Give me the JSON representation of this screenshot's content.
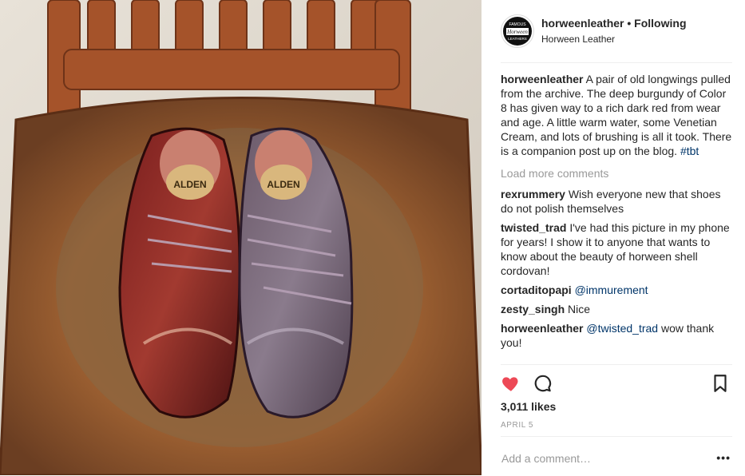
{
  "post": {
    "username": "horweenleather",
    "separator": "•",
    "follow_state": "Following",
    "location": "Horween Leather",
    "avatar_text": {
      "top": "FAMOUS",
      "middle": "Horween",
      "bottom": "LEATHERS"
    },
    "photo_brand": "ALDEN"
  },
  "caption": {
    "username": "horweenleather",
    "text": "A pair of old longwings pulled from the archive. The deep burgundy of Color 8 has given way to a rich dark red from wear and age. A little warm water, some Venetian Cream, and lots of brushing is all it took. There is a companion post up on the blog.",
    "hashtag": "#tbt"
  },
  "load_more": "Load more comments",
  "comments": [
    {
      "username": "rexrummery",
      "mention": "",
      "text": "Wish everyone new that shoes do not polish themselves"
    },
    {
      "username": "twisted_trad",
      "mention": "",
      "text": "I've had this picture in my phone for years! I show it to anyone that wants to know about the beauty of horween shell cordovan!"
    },
    {
      "username": "cortaditopapi",
      "mention": "@immurement",
      "text": ""
    },
    {
      "username": "zesty_singh",
      "mention": "",
      "text": "Nice"
    },
    {
      "username": "horweenleather",
      "mention": "@twisted_trad",
      "text": "wow thank you!"
    }
  ],
  "likes": "3,011 likes",
  "date": "APRIL 5",
  "add_comment_placeholder": "Add a comment…",
  "more_options": "•••",
  "colors": {
    "like": "#ed4956",
    "link": "#003569",
    "muted": "#999999"
  },
  "icons": [
    "heart-icon",
    "comment-icon",
    "bookmark-icon"
  ]
}
